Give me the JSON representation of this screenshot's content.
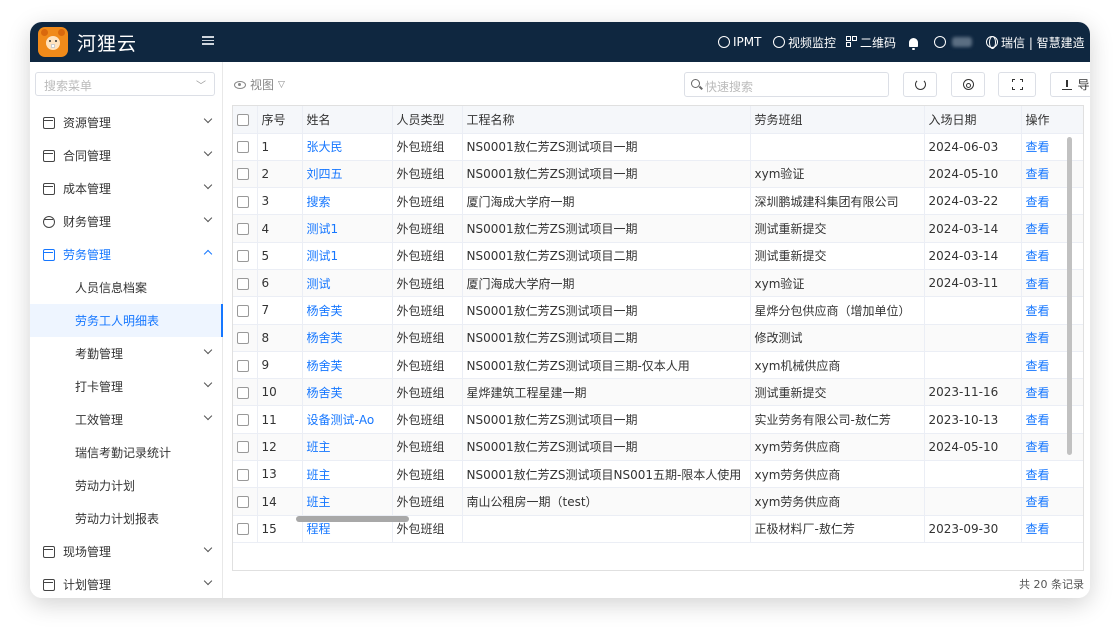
{
  "header": {
    "app_title": "河狸云",
    "nav": [
      {
        "label": "IPMT",
        "icon": "clock-icon"
      },
      {
        "label": "视频监控",
        "icon": "video-icon"
      },
      {
        "label": "二维码",
        "icon": "qrcode-icon"
      }
    ],
    "org": "瑞信 | 智慧建造"
  },
  "sidebar": {
    "search_placeholder": "搜索菜单",
    "items": [
      {
        "label": "资源管理",
        "icon": "folder-icon"
      },
      {
        "label": "合同管理",
        "icon": "document-icon"
      },
      {
        "label": "成本管理",
        "icon": "calculator-icon"
      },
      {
        "label": "财务管理",
        "icon": "gear-icon"
      },
      {
        "label": "劳务管理",
        "icon": "worker-icon"
      },
      {
        "label": "人员信息档案"
      },
      {
        "label": "劳务工人明细表"
      },
      {
        "label": "考勤管理"
      },
      {
        "label": "打卡管理"
      },
      {
        "label": "工效管理"
      },
      {
        "label": "瑞信考勤记录统计"
      },
      {
        "label": "劳动力计划"
      },
      {
        "label": "劳动力计划报表"
      },
      {
        "label": "现场管理",
        "icon": "site-icon"
      },
      {
        "label": "计划管理",
        "icon": "plan-icon"
      }
    ]
  },
  "toolbar": {
    "view_label": "视图",
    "search_placeholder": "快速搜索",
    "export_label": "导出"
  },
  "table": {
    "columns": [
      "序号",
      "姓名",
      "人员类型",
      "工程名称",
      "劳务班组",
      "入场日期",
      "操作"
    ],
    "rows": [
      [
        "1",
        "张大民",
        "外包班组",
        "NS0001敖仁芳ZS测试项目一期",
        "",
        "2024-06-03",
        "查看"
      ],
      [
        "2",
        "刘四五",
        "外包班组",
        "NS0001敖仁芳ZS测试项目一期",
        "xym验证",
        "2024-05-10",
        "查看"
      ],
      [
        "3",
        "搜索",
        "外包班组",
        "厦门海成大学府一期",
        "深圳鹏城建科集团有限公司",
        "2024-03-22",
        "查看"
      ],
      [
        "4",
        "测试1",
        "外包班组",
        "NS0001敖仁芳ZS测试项目一期",
        "测试重新提交",
        "2024-03-14",
        "查看"
      ],
      [
        "5",
        "测试1",
        "外包班组",
        "NS0001敖仁芳ZS测试项目二期",
        "测试重新提交",
        "2024-03-14",
        "查看"
      ],
      [
        "6",
        "测试",
        "外包班组",
        "厦门海成大学府一期",
        "xym验证",
        "2024-03-11",
        "查看"
      ],
      [
        "7",
        "杨舍芙",
        "外包班组",
        "NS0001敖仁芳ZS测试项目一期",
        "星烨分包供应商（增加单位）",
        "",
        "查看"
      ],
      [
        "8",
        "杨舍芙",
        "外包班组",
        "NS0001敖仁芳ZS测试项目二期",
        "修改测试",
        "",
        "查看"
      ],
      [
        "9",
        "杨舍芙",
        "外包班组",
        "NS0001敖仁芳ZS测试项目三期-仅本人用",
        "xym机械供应商",
        "",
        "查看"
      ],
      [
        "10",
        "杨舍芙",
        "外包班组",
        "星烨建筑工程星建一期",
        "测试重新提交",
        "2023-11-16",
        "查看"
      ],
      [
        "11",
        "设备测试-Ao",
        "外包班组",
        "NS0001敖仁芳ZS测试项目一期",
        "实业劳务有限公司-敖仁芳",
        "2023-10-13",
        "查看"
      ],
      [
        "12",
        "班主",
        "外包班组",
        "NS0001敖仁芳ZS测试项目一期",
        "xym劳务供应商",
        "2024-05-10",
        "查看"
      ],
      [
        "13",
        "班主",
        "外包班组",
        "NS0001敖仁芳ZS测试项目NS001五期-限本人使用",
        "xym劳务供应商",
        "",
        "查看"
      ],
      [
        "14",
        "班主",
        "外包班组",
        "南山公租房一期（test）",
        "xym劳务供应商",
        "",
        "查看"
      ],
      [
        "15",
        "程程",
        "外包班组",
        "",
        "正极材料厂-敖仁芳",
        "2023-09-30",
        "查看"
      ]
    ]
  },
  "footer": {
    "total": "共 20 条记录"
  },
  "colors": {
    "header_bg": "#0f2740",
    "accent": "#1677ff",
    "logo": "#f08a1a"
  }
}
